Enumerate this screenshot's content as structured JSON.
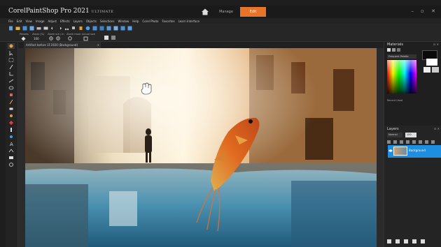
{
  "app": {
    "title_brand": "Corel",
    "title_product": "PaintShop",
    "title_rest": " Pro 2021",
    "title_edition": "ULTIMATE",
    "tabs": [
      {
        "label": "Manage",
        "active": false
      },
      {
        "label": "Edit",
        "active": true
      }
    ],
    "window_controls": "– ▫ ✕"
  },
  "menu": [
    "File",
    "Edit",
    "View",
    "Image",
    "Adjust",
    "Effects",
    "Layers",
    "Objects",
    "Selections",
    "Window",
    "Help",
    "Corel Photo",
    "Favorites",
    "Learn Interface"
  ],
  "tool_options": {
    "labels": [
      "Presets",
      "Zoom (%)",
      "Zoom out / in",
      "Zoom more",
      "Actual size"
    ],
    "values": [
      "",
      "100",
      "",
      "",
      ""
    ]
  },
  "document": {
    "tab_label": "Artifact before 1F.1920 (Background)",
    "close": "✕"
  },
  "materials": {
    "title": "Materials",
    "swatches_label": "Frequent Palette",
    "recent_label": "Recent Used"
  },
  "layers": {
    "title": "Layers",
    "blend_label": "Normal",
    "opacity_label": "100",
    "layer_name": "Background"
  },
  "colors": {
    "accent": "#e8742a",
    "selection": "#1e8fe0",
    "panel_bg": "#1f1f1f"
  }
}
